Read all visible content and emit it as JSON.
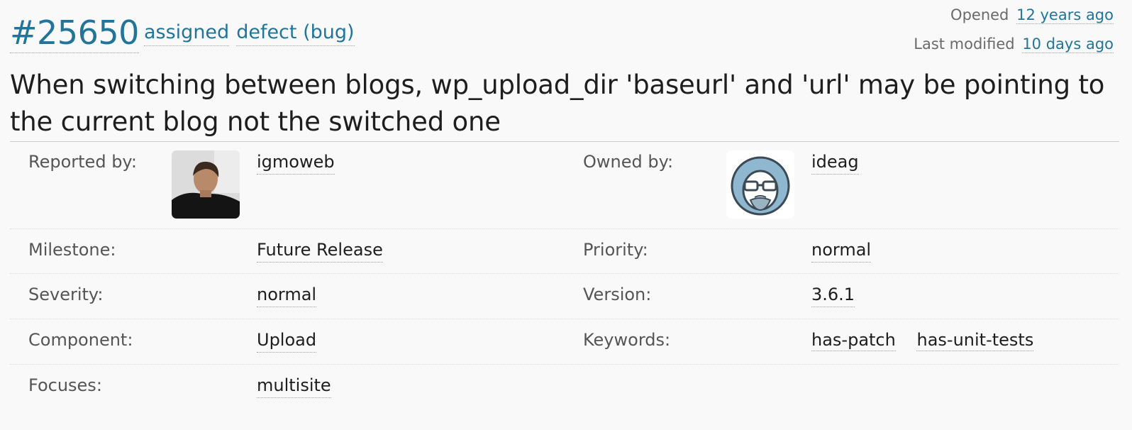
{
  "ticket": {
    "id": "#25650",
    "status": "assigned",
    "type": "defect (bug)",
    "opened_label": "Opened",
    "opened_value": "12 years ago",
    "modified_label": "Last modified",
    "modified_value": "10 days ago",
    "summary": "When switching between blogs, wp_upload_dir 'baseurl' and 'url' may be pointing to the current blog not the switched one"
  },
  "properties": {
    "reported_by_label": "Reported by:",
    "reporter": "igmoweb",
    "owned_by_label": "Owned by:",
    "owner": "ideag",
    "milestone_label": "Milestone:",
    "milestone": "Future Release",
    "priority_label": "Priority:",
    "priority": "normal",
    "severity_label": "Severity:",
    "severity": "normal",
    "version_label": "Version:",
    "version": "3.6.1",
    "component_label": "Component:",
    "component": "Upload",
    "keywords_label": "Keywords:",
    "keywords": [
      "has-patch",
      "has-unit-tests"
    ],
    "focuses_label": "Focuses:",
    "focuses": "multisite"
  },
  "colors": {
    "link": "#21759b",
    "text": "#1e1e1e",
    "label": "#555555",
    "background": "#f9f9f9"
  }
}
